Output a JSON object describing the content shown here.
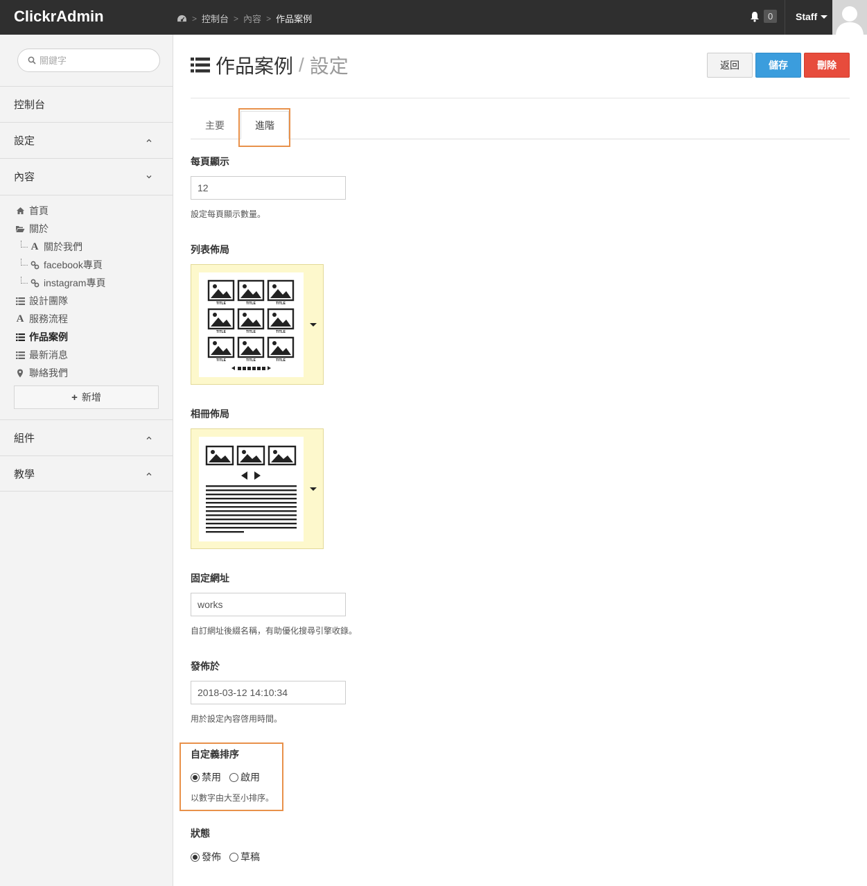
{
  "app": {
    "brand": "ClickrAdmin"
  },
  "breadcrumb": {
    "items": [
      "控制台",
      "內容",
      "作品案例"
    ]
  },
  "topbar": {
    "notification_count": "0",
    "user_label": "Staff"
  },
  "sidebar": {
    "search_placeholder": "關鍵字",
    "sections": {
      "dashboard": "控制台",
      "settings": "設定",
      "content": "內容",
      "components": "組件",
      "tutorial": "教學"
    },
    "content_items": [
      {
        "label": "首頁",
        "icon": "home-icon"
      },
      {
        "label": "關於",
        "icon": "folder-open-icon"
      },
      {
        "label": "關於我們",
        "icon": "font-icon"
      },
      {
        "label": "facebook專頁",
        "icon": "link-icon"
      },
      {
        "label": "instagram專頁",
        "icon": "link-icon"
      },
      {
        "label": "設計團隊",
        "icon": "list-icon"
      },
      {
        "label": "服務流程",
        "icon": "font-icon"
      },
      {
        "label": "作品案例",
        "icon": "list-icon",
        "active": true
      },
      {
        "label": "最新消息",
        "icon": "list-icon"
      },
      {
        "label": "聯絡我們",
        "icon": "map-marker-icon"
      }
    ],
    "add_label": "新增"
  },
  "page": {
    "title": "作品案例",
    "subtitle": "設定",
    "buttons": {
      "back": "返回",
      "save": "儲存",
      "delete": "刪除"
    },
    "tabs": [
      "主要",
      "進階"
    ],
    "active_tab": "進階"
  },
  "form": {
    "per_page": {
      "label": "每頁顯示",
      "value": "12",
      "help": "設定每頁顯示數量。"
    },
    "list_layout": {
      "label": "列表佈局",
      "tile_caption": "TITLE"
    },
    "album_layout": {
      "label": "相冊佈局"
    },
    "permalink": {
      "label": "固定網址",
      "value": "works",
      "help": "自訂網址後綴名稱，有助優化搜尋引擎收錄。"
    },
    "published_at": {
      "label": "發佈於",
      "value": "2018-03-12 14:10:34",
      "help": "用於設定內容啓用時間。"
    },
    "custom_sort": {
      "label": "自定義排序",
      "options": [
        "禁用",
        "啟用"
      ],
      "selected": "禁用",
      "help": "以數字由大至小排序。"
    },
    "status": {
      "label": "狀態",
      "options": [
        "發佈",
        "草稿"
      ],
      "selected": "發佈"
    }
  },
  "colors": {
    "topbar": "#2f2f2f",
    "save": "#3b9ddd",
    "delete": "#e74c3c",
    "highlight": "#e8914a",
    "layout_bg": "#fdf8cc"
  }
}
